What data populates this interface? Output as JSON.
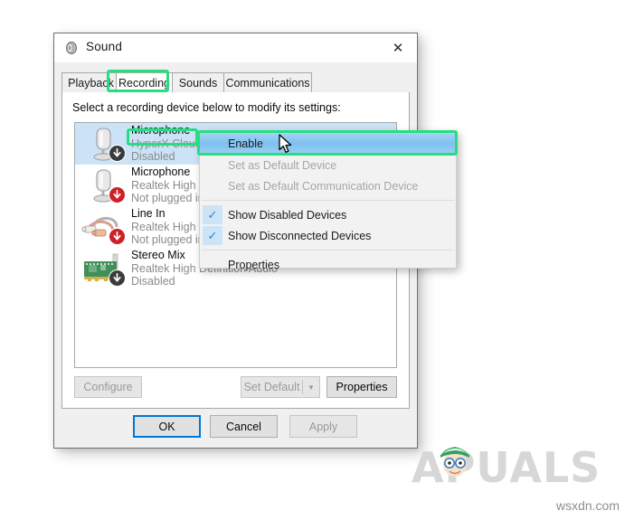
{
  "window": {
    "title": "Sound",
    "icon": "speaker-icon",
    "close_label": "✕"
  },
  "tabs": [
    {
      "label": "Playback",
      "selected": false
    },
    {
      "label": "Recording",
      "selected": true
    },
    {
      "label": "Sounds",
      "selected": false
    },
    {
      "label": "Communications",
      "selected": false
    }
  ],
  "panel": {
    "instruction": "Select a recording device below to modify its settings:"
  },
  "devices": [
    {
      "name": "Microphone",
      "maker": "HyperX Cloud",
      "status": "Disabled",
      "icon": "microphone-icon",
      "badge": "down-arrow-dark-badge",
      "selected": true
    },
    {
      "name": "Microphone",
      "maker": "Realtek High Definition Audio",
      "status": "Not plugged in",
      "icon": "microphone-icon",
      "badge": "down-arrow-red-badge",
      "selected": false
    },
    {
      "name": "Line In",
      "maker": "Realtek High Definition Audio",
      "status": "Not plugged in",
      "icon": "rca-cable-icon",
      "badge": "down-arrow-red-badge",
      "selected": false
    },
    {
      "name": "Stereo Mix",
      "maker": "Realtek High Definition Audio",
      "status": "Disabled",
      "icon": "sound-card-icon",
      "badge": "down-arrow-dark-badge",
      "selected": false
    }
  ],
  "device_buttons": {
    "configure": "Configure",
    "set_default": "Set Default",
    "set_default_arrow": "▼",
    "properties": "Properties"
  },
  "dialog_buttons": {
    "ok": "OK",
    "cancel": "Cancel",
    "apply": "Apply"
  },
  "context_menu": {
    "items": [
      {
        "label": "Enable",
        "state": "highlighted",
        "checked": false
      },
      {
        "label": "Set as Default Device",
        "state": "disabled",
        "checked": false
      },
      {
        "label": "Set as Default Communication Device",
        "state": "disabled",
        "checked": false
      },
      {
        "label": "Show Disabled Devices",
        "state": "normal",
        "checked": true
      },
      {
        "label": "Show Disconnected Devices",
        "state": "normal",
        "checked": true
      },
      {
        "label": "Properties",
        "state": "normal",
        "checked": false
      }
    ],
    "check_glyph": "✓"
  },
  "annotations": {
    "highlight_color": "#26de81",
    "boxes": [
      {
        "target": "recording-tab"
      },
      {
        "target": "microphone-device-name"
      },
      {
        "target": "enable-menu-item"
      }
    ]
  },
  "watermarks": {
    "brand": "PUALS",
    "brand_first_letter": "A",
    "site": "wsxdn.com"
  }
}
